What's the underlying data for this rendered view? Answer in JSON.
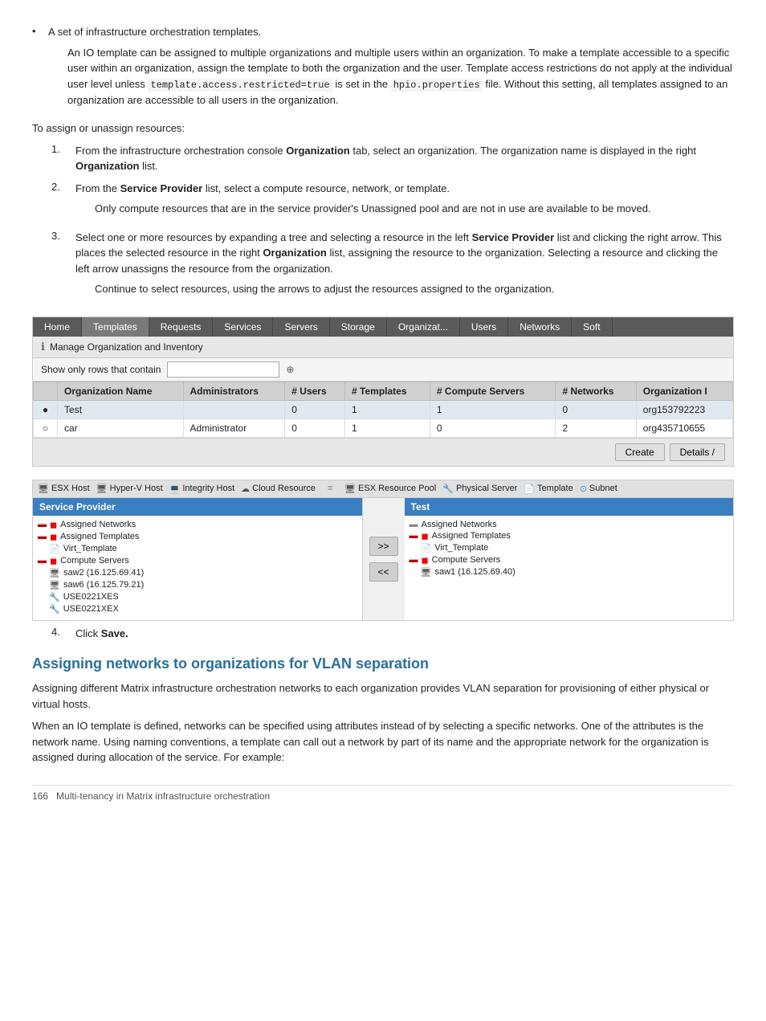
{
  "bullet1": {
    "text": "A set of infrastructure orchestration templates.",
    "description": "An IO template can be assigned to multiple organizations and multiple users within an organization. To make a template accessible to a specific user within an organization, assign the template to both the organization and the user. Template access restrictions do not apply at the individual user level unless ",
    "code1": "template.access.restricted=true",
    "desc2": " is set in the ",
    "code2": "hpio.properties",
    "desc3": " file. Without this setting, all templates assigned to an organization are accessible to all users in the organization."
  },
  "assign_intro": "To assign or unassign resources:",
  "steps": [
    {
      "num": "1.",
      "text1": "From the infrastructure orchestration console ",
      "bold1": "Organization",
      "text2": " tab, select an organization. The organization name is displayed in the right ",
      "bold2": "Organization",
      "text3": " list."
    },
    {
      "num": "2.",
      "text1": "From the ",
      "bold1": "Service Provider",
      "text2": " list, select a compute resource, network, or template.",
      "indent": "Only compute resources that are in the service provider's Unassigned pool and are not in use are available to be moved."
    },
    {
      "num": "3.",
      "text1": "Select one or more resources by expanding a tree and selecting a resource in the left ",
      "bold1": "Service Provider",
      "text2": " list and clicking the right arrow. This places the selected resource in the right ",
      "bold2": "Organization",
      "text3": " list, assigning the resource to the organization. Selecting a resource and clicking the left arrow unassigns the resource from the organization.",
      "indent": "Continue to select resources, using the arrows to adjust the resources assigned to the organization."
    }
  ],
  "nav": {
    "items": [
      {
        "label": "Home",
        "active": false
      },
      {
        "label": "Templates",
        "active": true
      },
      {
        "label": "Requests",
        "active": false
      },
      {
        "label": "Services",
        "active": false
      },
      {
        "label": "Servers",
        "active": false
      },
      {
        "label": "Storage",
        "active": false
      },
      {
        "label": "Organizat...",
        "active": false
      },
      {
        "label": "Users",
        "active": false
      },
      {
        "label": "Networks",
        "active": false
      },
      {
        "label": "Soft",
        "active": false
      }
    ]
  },
  "manage_bar": "Manage Organization and Inventory",
  "filter_label": "Show only rows that contain",
  "table": {
    "headers": [
      "",
      "Organization Name",
      "Administrators",
      "# Users",
      "# Templates",
      "# Compute Servers",
      "# Networks",
      "Organization I"
    ],
    "rows": [
      {
        "selected": true,
        "radio": "●",
        "org": "Test",
        "admin": "",
        "users": "0",
        "templates": "1",
        "compute": "1",
        "networks": "0",
        "id": "org153792223"
      },
      {
        "selected": false,
        "radio": "○",
        "org": "car",
        "admin": "Administrator",
        "users": "0",
        "templates": "1",
        "compute": "0",
        "networks": "2",
        "id": "org435710655"
      }
    ]
  },
  "buttons": {
    "create": "Create",
    "details": "Details /"
  },
  "resources_toolbar": {
    "items": [
      {
        "icon": "esx",
        "label": "ESX Host"
      },
      {
        "icon": "hyperv",
        "label": "Hyper-V Host"
      },
      {
        "icon": "integrity",
        "label": "Integrity Host"
      },
      {
        "icon": "cloud",
        "label": "Cloud Resource"
      },
      {
        "icon": "esxres",
        "label": "ESX Resource Pool"
      },
      {
        "icon": "physical",
        "label": "Physical Server"
      },
      {
        "icon": "template",
        "label": "Template"
      },
      {
        "icon": "subnet",
        "label": "Subnet"
      }
    ]
  },
  "service_provider": {
    "title": "Service Provider",
    "items": [
      {
        "label": "Assigned Networks",
        "indent": 0,
        "icon": "red"
      },
      {
        "label": "Assigned Templates",
        "indent": 0,
        "icon": "red"
      },
      {
        "label": "Virt_Template",
        "indent": 1,
        "icon": "template"
      },
      {
        "label": "Compute Servers",
        "indent": 0,
        "icon": "red"
      },
      {
        "label": "saw2 (16.125.69.41)",
        "indent": 1,
        "icon": "server"
      },
      {
        "label": "saw6 (16.125.79.21)",
        "indent": 1,
        "icon": "server"
      },
      {
        "label": "USE0221XES",
        "indent": 1,
        "icon": "server2"
      },
      {
        "label": "USE0221XEX",
        "indent": 1,
        "icon": "server2"
      }
    ]
  },
  "org_panel": {
    "title": "Test",
    "items": [
      {
        "label": "Assigned Networks",
        "indent": 0,
        "icon": "gray"
      },
      {
        "label": "Assigned Templates",
        "indent": 0,
        "icon": "red"
      },
      {
        "label": "Virt_Template",
        "indent": 1,
        "icon": "template"
      },
      {
        "label": "Compute Servers",
        "indent": 0,
        "icon": "red"
      },
      {
        "label": "saw1 (16.125.69.40)",
        "indent": 1,
        "icon": "server"
      }
    ]
  },
  "arrows": {
    "right": ">>",
    "left": "<<"
  },
  "step4": {
    "num": "4.",
    "text": "Click ",
    "bold": "Save."
  },
  "section_heading": "Assigning networks to organizations for VLAN separation",
  "para1": "Assigning different Matrix infrastructure orchestration networks to each organization provides VLAN separation for provisioning of either physical or virtual hosts.",
  "para2": "When an IO template is defined, networks can be specified using attributes instead of by selecting a specific networks. One of the attributes is the network name. Using naming conventions, a template can call out a network by part of its name and the appropriate network for the organization is assigned during allocation of the service. For example:",
  "footer": {
    "page_num": "166",
    "text": "Multi-tenancy in Matrix infrastructure orchestration"
  }
}
